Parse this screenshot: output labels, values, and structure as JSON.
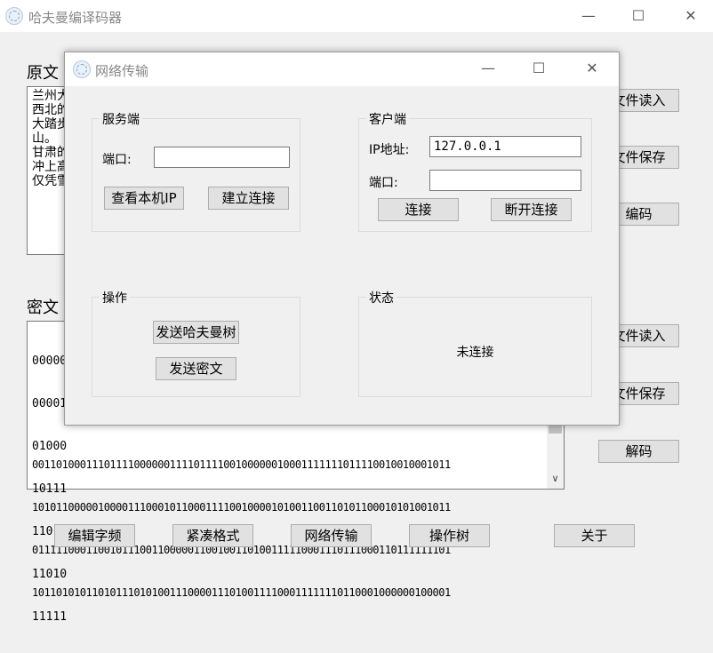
{
  "main_window": {
    "title": "哈夫曼编译码器",
    "original_label": "原文",
    "cipher_label": "密文",
    "original_lines": [
      "兰州大",
      "西北的",
      "大踏步",
      "山。",
      "甘肃的",
      "冲上高",
      "仅凭雪"
    ],
    "cipher_lines_visible_behind": [
      "00000",
      "00001",
      "01000",
      "10111",
      "11011",
      "11010",
      "11111"
    ],
    "cipher_lines": [
      "0011010001110111100000011110111100100000010001111111011110010010001011",
      "1010110000010000111000101100011110010000101001100110101100010101001011",
      "0111110001100101110011000001100100110100111110001110111000110111111101",
      "1011010101101011101010011100001110100111100011111110110001000000100001"
    ],
    "buttons": {
      "file_read_1": "文件读入",
      "file_save_1": "文件保存",
      "encode": "编码",
      "file_read_2": "文件读入",
      "file_save_2": "文件保存",
      "decode": "解码",
      "edit_char_freq": "编辑字频",
      "compact_format": "紧凑格式",
      "network": "网络传输",
      "operate_tree": "操作树",
      "about": "关于"
    }
  },
  "dialog": {
    "title": "网络传输",
    "server": {
      "group_label": "服务端",
      "port_label": "端口:",
      "port_value": "",
      "view_ip_button": "查看本机IP",
      "listen_button": "建立连接"
    },
    "client": {
      "group_label": "客户端",
      "ip_label": "IP地址:",
      "ip_value": "127.0.0.1",
      "port_label": "端口:",
      "port_value": "",
      "connect_button": "连接",
      "disconnect_button": "断开连接"
    },
    "operation": {
      "group_label": "操作",
      "send_tree_button": "发送哈夫曼树",
      "send_cipher_button": "发送密文"
    },
    "status": {
      "group_label": "状态",
      "status_text": "未连接"
    }
  },
  "window_controls": {
    "minimize": "—",
    "maximize": "☐",
    "close": "✕"
  }
}
